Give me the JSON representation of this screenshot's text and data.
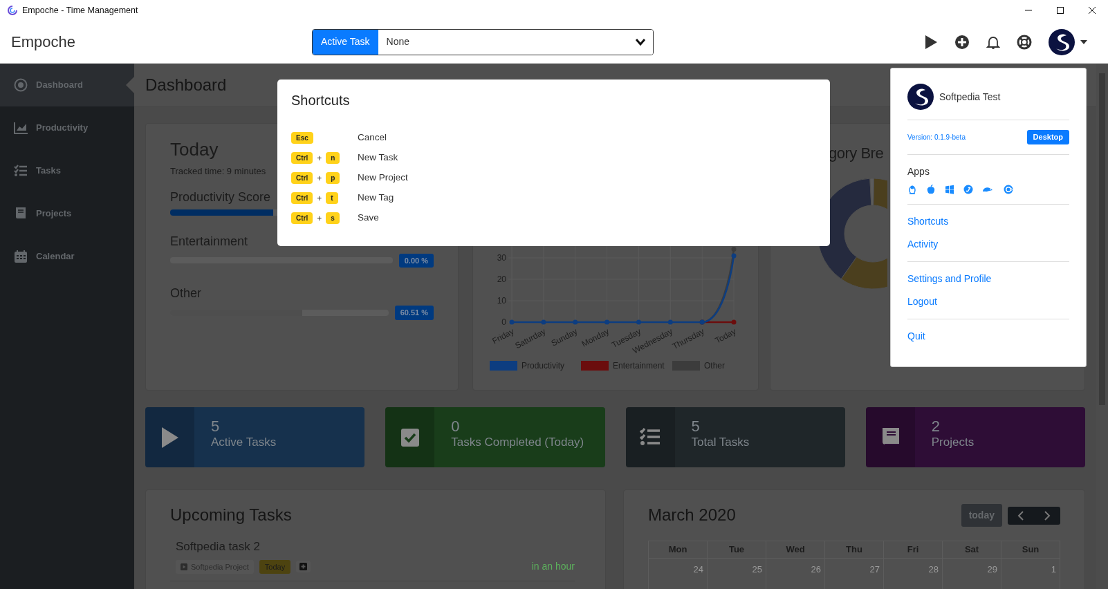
{
  "window": {
    "title": "Empoche - Time Management"
  },
  "header": {
    "brand": "Empoche",
    "active_task": {
      "label": "Active Task",
      "value": "None"
    }
  },
  "sidebar": {
    "items": [
      {
        "label": "Dashboard",
        "selected": true
      },
      {
        "label": "Productivity",
        "selected": false
      },
      {
        "label": "Tasks",
        "selected": false
      },
      {
        "label": "Projects",
        "selected": false
      },
      {
        "label": "Calendar",
        "selected": false
      }
    ]
  },
  "page": {
    "title": "Dashboard"
  },
  "today_card": {
    "title": "Today",
    "tracked": "Tracked time: 9 minutes",
    "metrics": [
      {
        "label": "Productivity Score",
        "level": 0.39
      },
      {
        "label": "Entertainment",
        "level": 0,
        "reading": "0.00 %"
      },
      {
        "label": "Other",
        "level": 0.6051,
        "reading": "60.51 %"
      }
    ]
  },
  "trend_card": {
    "chart_data": {
      "type": "line",
      "categories": [
        "Friday",
        "Saturday",
        "Sunday",
        "Monday",
        "Tuesday",
        "Wednesday",
        "Thursday",
        "Today"
      ],
      "ylim": [
        0,
        60
      ],
      "yticks": [
        0,
        10,
        20,
        30
      ],
      "grid": true,
      "legend": "bottom",
      "series": [
        {
          "name": "Productivity",
          "color": "#0d3d80",
          "marker": "circle",
          "values": [
            0,
            0,
            0,
            0,
            0,
            0,
            0,
            31
          ]
        },
        {
          "name": "Entertainment",
          "color": "#6b0d0d",
          "marker": "circle",
          "values": [
            null,
            null,
            null,
            null,
            null,
            null,
            0,
            0
          ]
        },
        {
          "name": "Other",
          "color": "#3c3c3c",
          "marker": "circle",
          "values": [
            null,
            null,
            null,
            null,
            null,
            null,
            0,
            34
          ]
        }
      ]
    }
  },
  "category_card": {
    "title": "gory Bre"
  },
  "stats": [
    {
      "value": "5",
      "label": "Active Tasks",
      "color": "#16314d"
    },
    {
      "value": "0",
      "label": "Tasks Completed (Today)",
      "color": "#193d1a"
    },
    {
      "value": "5",
      "label": "Total Tasks",
      "color": "#1f2629"
    },
    {
      "value": "2",
      "label": "Projects",
      "color": "#2e0d36"
    }
  ],
  "upcoming": {
    "title": "Upcoming Tasks",
    "tasks": [
      {
        "name": "Softpedia task 2",
        "project": "Softpedia Project",
        "due": "Today",
        "when": "in an hour"
      }
    ]
  },
  "calendar": {
    "title": "March 2020",
    "today_button": "today",
    "weekdays": [
      "Mon",
      "Tue",
      "Wed",
      "Thu",
      "Fri",
      "Sat",
      "Sun"
    ],
    "days": [
      "24",
      "25",
      "26",
      "27",
      "28",
      "29",
      "1"
    ]
  },
  "shortcuts_modal": {
    "title": "Shortcuts",
    "shortcuts": [
      {
        "keys": [
          "Esc"
        ],
        "action": "Cancel"
      },
      {
        "keys": [
          "Ctrl",
          "n"
        ],
        "joiner": "+",
        "action": "New Task"
      },
      {
        "keys": [
          "Ctrl",
          "p"
        ],
        "joiner": "+",
        "action": "New Project"
      },
      {
        "keys": [
          "Ctrl",
          "t"
        ],
        "joiner": "+",
        "action": "New Tag"
      },
      {
        "keys": [
          "Ctrl",
          "s"
        ],
        "joiner": "+",
        "action": "Save"
      }
    ]
  },
  "user_menu": {
    "name": "Softpedia Test",
    "version": "Version: 0.1.9-beta",
    "platform": "Desktop",
    "apps_label": "Apps",
    "link_groups": [
      [
        "Shortcuts",
        "Activity"
      ],
      [
        "Settings and Profile",
        "Logout"
      ],
      [
        "Quit"
      ]
    ]
  }
}
